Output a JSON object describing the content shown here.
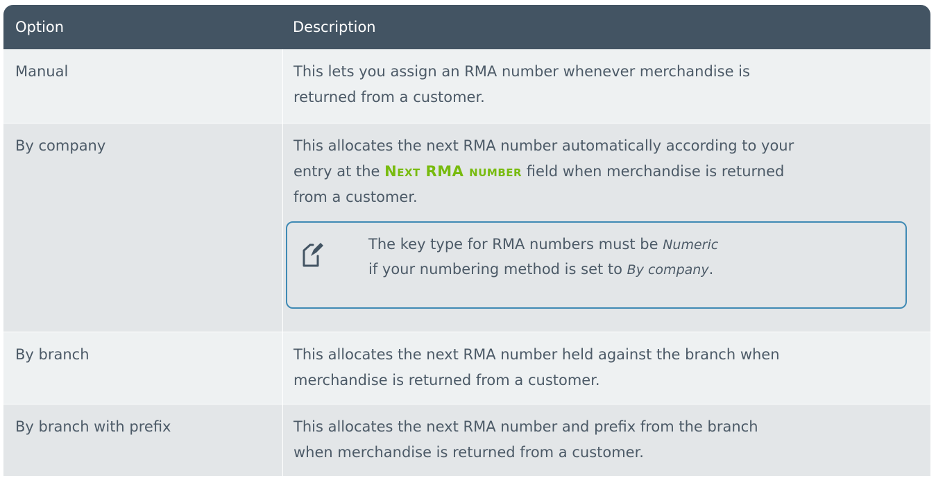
{
  "table": {
    "header": {
      "option": "Option",
      "description": "Description"
    },
    "rows": [
      {
        "option": "Manual",
        "description_line1": "This lets you assign an RMA number whenever merchandise is",
        "description_line2": "returned from a customer."
      },
      {
        "option": "By company",
        "description_line1": "This allocates the next RMA number automatically according to your",
        "description_pre": "entry at the ",
        "field_ref": "Next RMA number",
        "description_post": " field when merchandise is returned",
        "description_line3": "from a customer.",
        "note": {
          "line1_pre": "The key type for RMA numbers must be ",
          "line1_em": "Numeric",
          "line2_pre": "if your numbering method is set to ",
          "line2_em": "By company",
          "line2_post": "."
        }
      },
      {
        "option": "By branch",
        "description_line1": "This allocates the next RMA number held against the branch when",
        "description_line2": "merchandise is returned from a customer."
      },
      {
        "option": "By branch with prefix",
        "description_line1": "This allocates the next RMA number and prefix from the branch",
        "description_line2": "when merchandise is returned from a customer."
      }
    ]
  },
  "icons": {
    "note_icon": "note-edit-icon"
  },
  "colors": {
    "header_bg": "#435463",
    "field_ref": "#78bb0f",
    "note_border": "#3f8ab4",
    "row_light": "#eef1f2",
    "row_dark": "#e3e6e8"
  }
}
